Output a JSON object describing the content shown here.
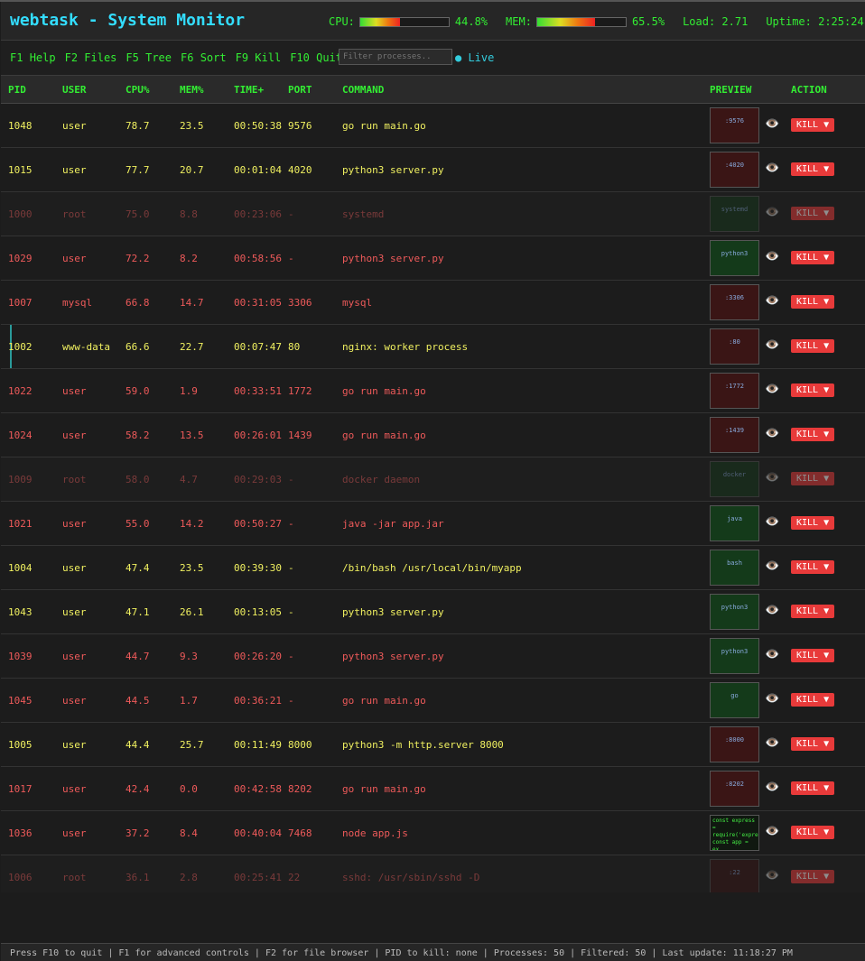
{
  "header": {
    "title": "webtask - System Monitor",
    "cpu_label": "CPU:",
    "cpu_value": "44.8%",
    "cpu_fraction": 0.448,
    "mem_label": "MEM:",
    "mem_value": "65.5%",
    "mem_fraction": 0.655,
    "load": "Load: 2.71",
    "uptime": "Uptime: 2:25:24"
  },
  "toolbar": {
    "keys": [
      {
        "key": "F1",
        "label": "Help"
      },
      {
        "key": "F2",
        "label": "Files"
      },
      {
        "key": "F5",
        "label": "Tree"
      },
      {
        "key": "F6",
        "label": "Sort"
      },
      {
        "key": "F9",
        "label": "Kill"
      },
      {
        "key": "F10",
        "label": "Quit"
      }
    ],
    "filter_placeholder": "Filter processes..",
    "live": "● Live"
  },
  "columns": [
    "PID",
    "USER",
    "CPU%",
    "MEM%",
    "TIME+",
    "PORT",
    "COMMAND",
    "PREVIEW",
    "ACTION"
  ],
  "rows": [
    {
      "pid": "1048",
      "user": "user",
      "cpu": "78.7",
      "mem": "23.5",
      "time": "00:50:38",
      "port": "9576",
      "cmd": "go run main.go",
      "style": "hot",
      "thumb": "red",
      "thumb_text": ":9576"
    },
    {
      "pid": "1015",
      "user": "user",
      "cpu": "77.7",
      "mem": "20.7",
      "time": "00:01:04",
      "port": "4020",
      "cmd": "python3 server.py",
      "style": "hot",
      "thumb": "red",
      "thumb_text": ":4020"
    },
    {
      "pid": "1000",
      "user": "root",
      "cpu": "75.0",
      "mem": "8.8",
      "time": "00:23:06",
      "port": "-",
      "cmd": "systemd",
      "style": "sys",
      "thumb": "green",
      "thumb_text": "systemd"
    },
    {
      "pid": "1029",
      "user": "user",
      "cpu": "72.2",
      "mem": "8.2",
      "time": "00:58:56",
      "port": "-",
      "cmd": "python3 server.py",
      "style": "warm",
      "thumb": "green",
      "thumb_text": "python3"
    },
    {
      "pid": "1007",
      "user": "mysql",
      "cpu": "66.8",
      "mem": "14.7",
      "time": "00:31:05",
      "port": "3306",
      "cmd": "mysql",
      "style": "warm",
      "thumb": "red",
      "thumb_text": ":3306"
    },
    {
      "pid": "1002",
      "user": "www-data",
      "cpu": "66.6",
      "mem": "22.7",
      "time": "00:07:47",
      "port": "80",
      "cmd": "nginx: worker process",
      "style": "hot",
      "thumb": "red",
      "thumb_text": ":80",
      "marked": true
    },
    {
      "pid": "1022",
      "user": "user",
      "cpu": "59.0",
      "mem": "1.9",
      "time": "00:33:51",
      "port": "1772",
      "cmd": "go run main.go",
      "style": "warm",
      "thumb": "red",
      "thumb_text": ":1772"
    },
    {
      "pid": "1024",
      "user": "user",
      "cpu": "58.2",
      "mem": "13.5",
      "time": "00:26:01",
      "port": "1439",
      "cmd": "go run main.go",
      "style": "warm",
      "thumb": "red",
      "thumb_text": ":1439"
    },
    {
      "pid": "1009",
      "user": "root",
      "cpu": "58.0",
      "mem": "4.7",
      "time": "00:29:03",
      "port": "-",
      "cmd": "docker daemon",
      "style": "sys",
      "thumb": "green",
      "thumb_text": "docker"
    },
    {
      "pid": "1021",
      "user": "user",
      "cpu": "55.0",
      "mem": "14.2",
      "time": "00:50:27",
      "port": "-",
      "cmd": "java -jar app.jar",
      "style": "warm",
      "thumb": "green",
      "thumb_text": "java"
    },
    {
      "pid": "1004",
      "user": "user",
      "cpu": "47.4",
      "mem": "23.5",
      "time": "00:39:30",
      "port": "-",
      "cmd": "/bin/bash /usr/local/bin/myapp",
      "style": "hot",
      "thumb": "green",
      "thumb_text": "bash"
    },
    {
      "pid": "1043",
      "user": "user",
      "cpu": "47.1",
      "mem": "26.1",
      "time": "00:13:05",
      "port": "-",
      "cmd": "python3 server.py",
      "style": "hot",
      "thumb": "green",
      "thumb_text": "python3"
    },
    {
      "pid": "1039",
      "user": "user",
      "cpu": "44.7",
      "mem": "9.3",
      "time": "00:26:20",
      "port": "-",
      "cmd": "python3 server.py",
      "style": "warm",
      "thumb": "green",
      "thumb_text": "python3"
    },
    {
      "pid": "1045",
      "user": "user",
      "cpu": "44.5",
      "mem": "1.7",
      "time": "00:36:21",
      "port": "-",
      "cmd": "go run main.go",
      "style": "warm",
      "thumb": "green",
      "thumb_text": "go"
    },
    {
      "pid": "1005",
      "user": "user",
      "cpu": "44.4",
      "mem": "25.7",
      "time": "00:11:49",
      "port": "8000",
      "cmd": "python3 -m http.server 8000",
      "style": "hot",
      "thumb": "red",
      "thumb_text": ":8000"
    },
    {
      "pid": "1017",
      "user": "user",
      "cpu": "42.4",
      "mem": "0.0",
      "time": "00:42:58",
      "port": "8202",
      "cmd": "go run main.go",
      "style": "warm",
      "thumb": "red",
      "thumb_text": ":8202"
    },
    {
      "pid": "1036",
      "user": "user",
      "cpu": "37.2",
      "mem": "8.4",
      "time": "00:40:04",
      "port": "7468",
      "cmd": "node app.js",
      "style": "warm",
      "thumb": "code",
      "thumb_text": "const express = require('express') const app = ex..."
    },
    {
      "pid": "1006",
      "user": "root",
      "cpu": "36.1",
      "mem": "2.8",
      "time": "00:25:41",
      "port": "22",
      "cmd": "sshd: /usr/sbin/sshd -D",
      "style": "sys",
      "thumb": "red",
      "thumb_text": ":22"
    }
  ],
  "kill_label": "KILL ▼",
  "eye_icon": "👁️",
  "footer": "Press F10 to quit | F1 for advanced controls | F2 for file browser | PID to kill: none | Processes: 50 | Filtered: 50 | Last update: 11:18:27 PM"
}
